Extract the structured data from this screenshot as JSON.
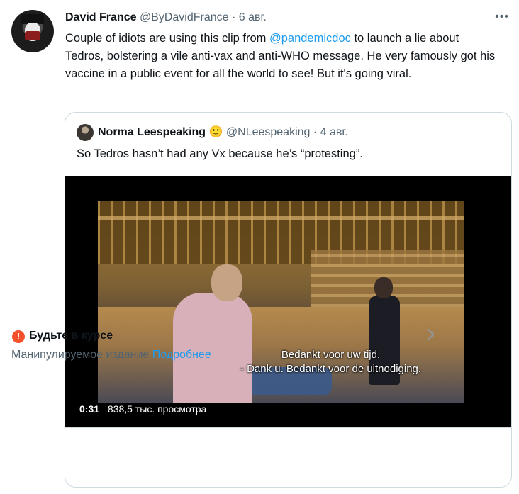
{
  "tweet": {
    "author_name": "David France",
    "author_handle": "@ByDavidFrance",
    "separator": "·",
    "date": "6 авг.",
    "text_part1": "Couple of idiots are using this clip from ",
    "mention": "@pandemicdoc",
    "text_part2": " to launch a lie about Tedros, bolstering a vile anti-vax and anti-WHO message. He very famously got his vaccine in a public event for all the world to see! But it's going viral.",
    "more_icon": "more-horizontal-icon"
  },
  "quote": {
    "author_name": "Norma Leespeaking",
    "author_emoji": "🙂",
    "author_handle": "@NLeespeaking",
    "separator": "·",
    "date": "4 авг.",
    "text": "So Tedros hasn’t had any Vx because he’s “protesting”.",
    "video": {
      "subtitle_line1": "Bedankt voor uw tijd.",
      "subtitle_line2": "- Dank u. Bedankt voor de uitnodiging.",
      "duration": "0:31",
      "views": "838,5 тыс. просмотра"
    },
    "notice": {
      "icon": "warning-icon",
      "title": "Будьте в курсе",
      "description": "Манипулируемое издание",
      "link": "Подробнее",
      "chevron_icon": "chevron-right-icon"
    }
  },
  "colors": {
    "link": "#1d9bf0",
    "secondary_text": "#536471",
    "warning": "#f4512c",
    "border": "#cfd9de"
  }
}
